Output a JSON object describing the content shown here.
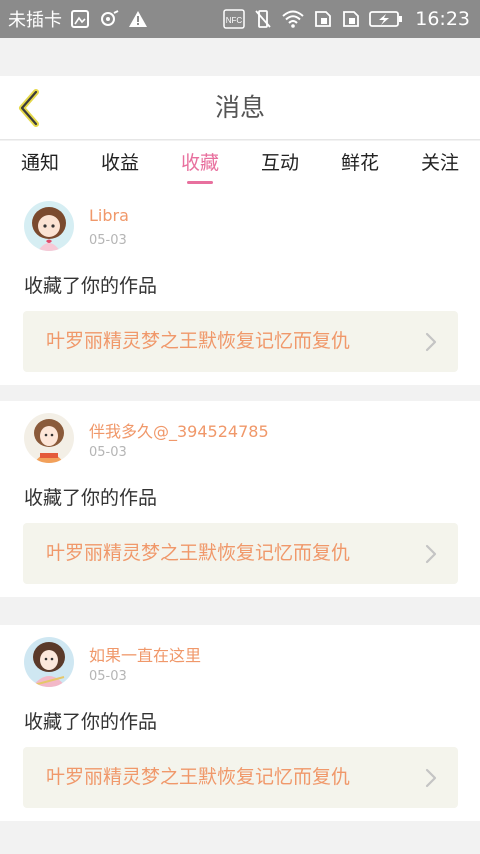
{
  "status_bar": {
    "carrier": "未插卡",
    "nfc": "NFC",
    "time": "16:23"
  },
  "header": {
    "title": "消息"
  },
  "tabs": [
    {
      "label": "通知",
      "active": false
    },
    {
      "label": "收益",
      "active": false
    },
    {
      "label": "收藏",
      "active": true
    },
    {
      "label": "互动",
      "active": false
    },
    {
      "label": "鲜花",
      "active": false
    },
    {
      "label": "关注",
      "active": false
    }
  ],
  "colors": {
    "accent": "#e8709e",
    "name": "#f0986a",
    "work_bg": "#f4f4ec"
  },
  "messages": [
    {
      "username": "Libra",
      "date": "05-03",
      "action": "收藏了你的作品",
      "work_title": "叶罗丽精灵梦之王默恢复记忆而复仇"
    },
    {
      "username": "伴我多久@_394524785",
      "date": "05-03",
      "action": "收藏了你的作品",
      "work_title": "叶罗丽精灵梦之王默恢复记忆而复仇"
    },
    {
      "username": "如果一直在这里",
      "date": "05-03",
      "action": "收藏了你的作品",
      "work_title": "叶罗丽精灵梦之王默恢复记忆而复仇"
    }
  ]
}
